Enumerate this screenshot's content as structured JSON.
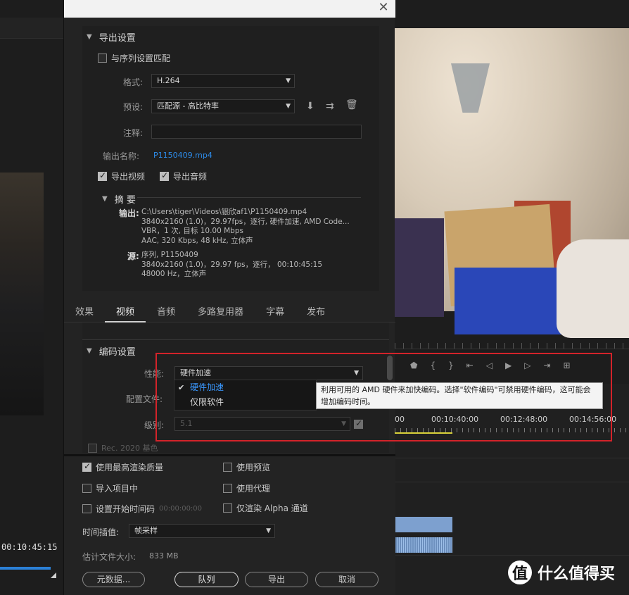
{
  "source_monitor": {
    "timecode": "00:10:45:15"
  },
  "timeline": {
    "ruler_labels": [
      "00",
      "00:10:40:00",
      "00:12:48:00",
      "00:14:56:00"
    ],
    "transport_icons": [
      "marker-icon",
      "in-point-icon",
      "out-point-icon",
      "go-to-in-icon",
      "step-back-icon",
      "play-icon",
      "step-forward-icon",
      "go-to-out-icon",
      "insert-icon"
    ]
  },
  "watermark": {
    "logo_char": "值",
    "text": "什么值得买"
  },
  "export": {
    "section_title": "导出设置",
    "match_sequence_label": "与序列设置匹配",
    "format_label": "格式:",
    "format_value": "H.264",
    "preset_label": "预设:",
    "preset_value": "匹配源 - 高比特率",
    "comment_label": "注释:",
    "comment_value": "",
    "output_name_label": "输出名称:",
    "output_name_value": "P1150409.mp4",
    "export_video_label": "导出视频",
    "export_audio_label": "导出音频",
    "export_video_checked": true,
    "export_audio_checked": true,
    "match_sequence_checked": false
  },
  "summary": {
    "title": "摘 要",
    "output_key": "输出:",
    "output_lines": [
      "C:\\Users\\tiger\\Videos\\银欣af1\\P1150409.mp4",
      "3840x2160 (1.0)，29.97fps，逐行, 硬件加速, AMD Code...",
      "VBR，1 次, 目标 10.00 Mbps",
      "AAC, 320 Kbps, 48  kHz, 立体声"
    ],
    "source_key": "源:",
    "source_lines": [
      "序列, P1150409",
      "3840x2160  (1.0)，29.97  fps，逐行，  00:10:45:15",
      "48000 Hz，立体声"
    ]
  },
  "tabs": [
    "效果",
    "视频",
    "音频",
    "多路复用器",
    "字幕",
    "发布"
  ],
  "active_tab": "视频",
  "encoding": {
    "section_title": "编码设置",
    "performance_label": "性能:",
    "performance_value": "硬件加速",
    "profile_label": "配置文件:",
    "level_label": "级别:",
    "level_value": "5.1",
    "rec2020_label": "Rec. 2020 基色"
  },
  "dropdown": {
    "options": [
      "硬件加速",
      "仅限软件"
    ],
    "selected": "硬件加速"
  },
  "tooltip": {
    "text": "利用可用的 AMD 硬件来加快编码。选择\"软件编码\"可禁用硬件编码，这可能会增加编码时间。"
  },
  "bottom": {
    "max_render_quality": "使用最高渲染质量",
    "use_previews": "使用预览",
    "import_into_project": "导入项目中",
    "use_proxies": "使用代理",
    "set_start_timecode": "设置开始时间码",
    "start_timecode_value": "00:00:00:00",
    "render_alpha_only": "仅渲染 Alpha 通道",
    "time_interpolation_label": "时间插值:",
    "time_interpolation_value": "帧采样",
    "file_size_label": "估计文件大小:",
    "file_size_value": "833 MB",
    "metadata_button": "元数据...",
    "queue_button": "队列",
    "export_button": "导出",
    "cancel_button": "取消",
    "max_render_checked": true
  },
  "colors": {
    "accent_blue": "#2d8ceb",
    "highlight_red": "#d3232a",
    "timeline_yellow": "#d9d23a"
  }
}
